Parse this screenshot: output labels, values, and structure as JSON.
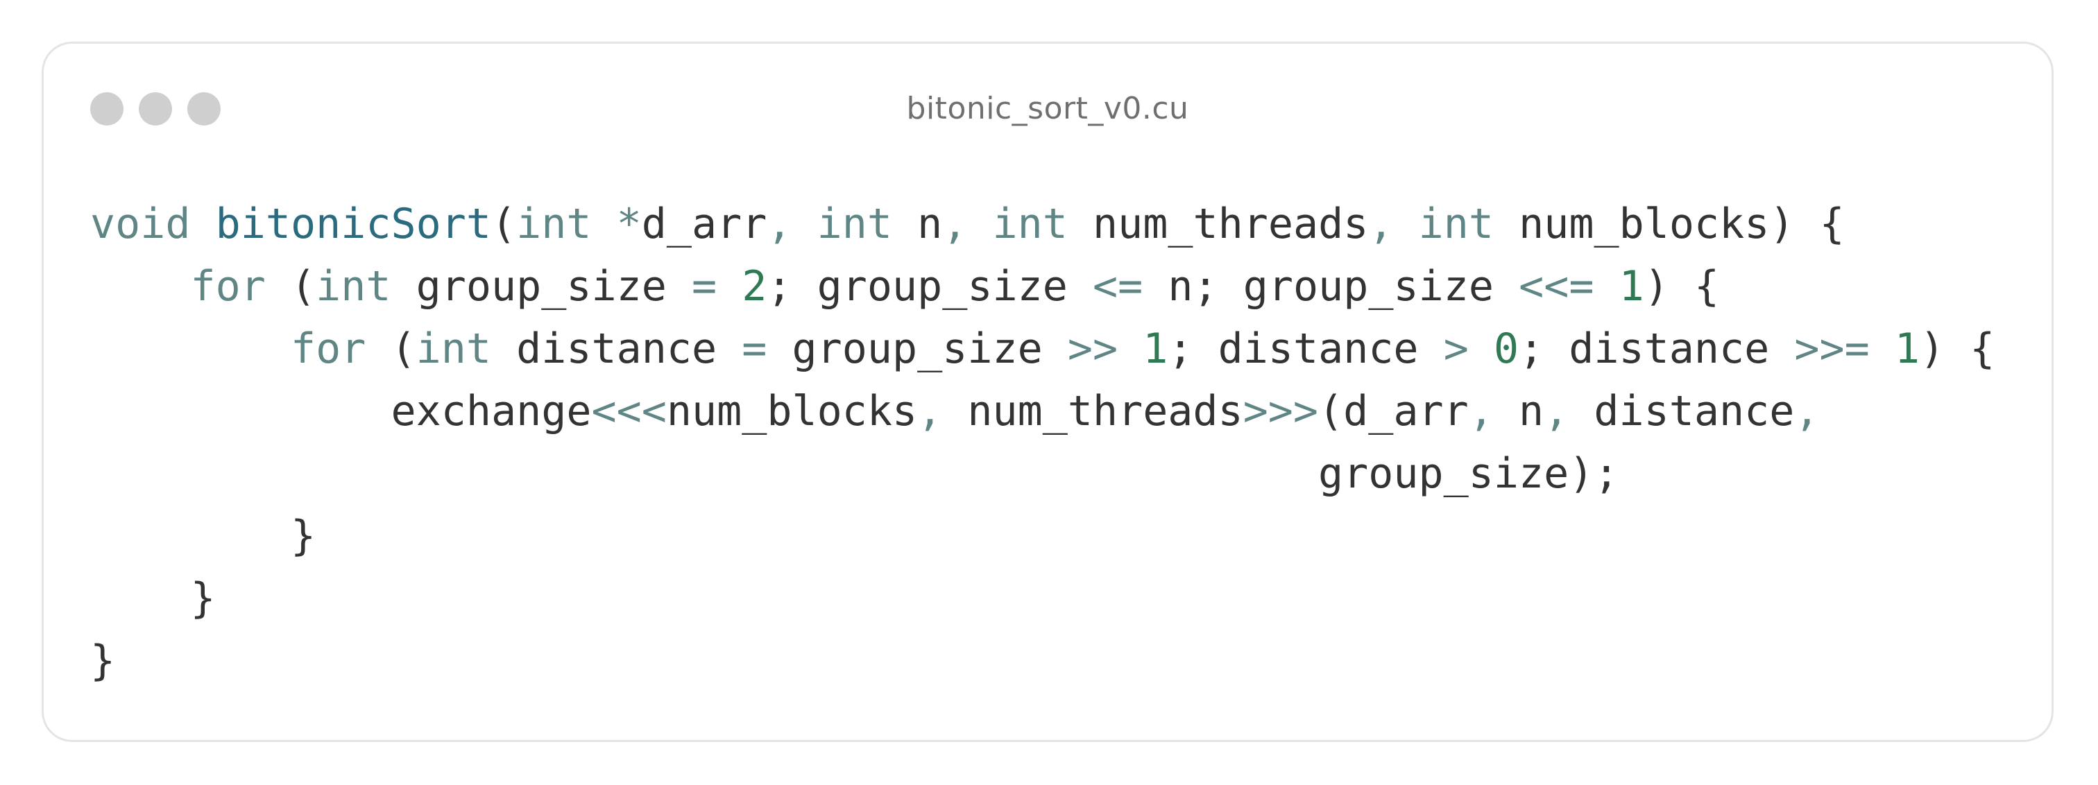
{
  "window": {
    "title": "bitonic_sort_v0.cu",
    "dots": [
      "window-dot-1",
      "window-dot-2",
      "window-dot-3"
    ]
  },
  "code": {
    "lines": [
      {
        "tokens": [
          {
            "t": "void",
            "c": "kw"
          },
          {
            "t": " ",
            "c": "id"
          },
          {
            "t": "bitonicSort",
            "c": "fn"
          },
          {
            "t": "(",
            "c": "id"
          },
          {
            "t": "int",
            "c": "kw"
          },
          {
            "t": " ",
            "c": "id"
          },
          {
            "t": "*",
            "c": "op"
          },
          {
            "t": "d_arr",
            "c": "id"
          },
          {
            "t": ",",
            "c": "op"
          },
          {
            "t": " ",
            "c": "id"
          },
          {
            "t": "int",
            "c": "kw"
          },
          {
            "t": " n",
            "c": "id"
          },
          {
            "t": ",",
            "c": "op"
          },
          {
            "t": " ",
            "c": "id"
          },
          {
            "t": "int",
            "c": "kw"
          },
          {
            "t": " num_threads",
            "c": "id"
          },
          {
            "t": ",",
            "c": "op"
          },
          {
            "t": " ",
            "c": "id"
          },
          {
            "t": "int",
            "c": "kw"
          },
          {
            "t": " num_blocks) {",
            "c": "id"
          }
        ]
      },
      {
        "tokens": [
          {
            "t": "    ",
            "c": "id"
          },
          {
            "t": "for",
            "c": "kw"
          },
          {
            "t": " (",
            "c": "id"
          },
          {
            "t": "int",
            "c": "kw"
          },
          {
            "t": " group_size ",
            "c": "id"
          },
          {
            "t": "=",
            "c": "op"
          },
          {
            "t": " ",
            "c": "id"
          },
          {
            "t": "2",
            "c": "num"
          },
          {
            "t": "; group_size ",
            "c": "id"
          },
          {
            "t": "<=",
            "c": "op"
          },
          {
            "t": " n; group_size ",
            "c": "id"
          },
          {
            "t": "<<=",
            "c": "op"
          },
          {
            "t": " ",
            "c": "id"
          },
          {
            "t": "1",
            "c": "num"
          },
          {
            "t": ") {",
            "c": "id"
          }
        ]
      },
      {
        "tokens": [
          {
            "t": "        ",
            "c": "id"
          },
          {
            "t": "for",
            "c": "kw"
          },
          {
            "t": " (",
            "c": "id"
          },
          {
            "t": "int",
            "c": "kw"
          },
          {
            "t": " distance ",
            "c": "id"
          },
          {
            "t": "=",
            "c": "op"
          },
          {
            "t": " group_size ",
            "c": "id"
          },
          {
            "t": ">>",
            "c": "op"
          },
          {
            "t": " ",
            "c": "id"
          },
          {
            "t": "1",
            "c": "num"
          },
          {
            "t": "; distance ",
            "c": "id"
          },
          {
            "t": ">",
            "c": "op"
          },
          {
            "t": " ",
            "c": "id"
          },
          {
            "t": "0",
            "c": "num"
          },
          {
            "t": "; distance ",
            "c": "id"
          },
          {
            "t": ">>=",
            "c": "op"
          },
          {
            "t": " ",
            "c": "id"
          },
          {
            "t": "1",
            "c": "num"
          },
          {
            "t": ") {",
            "c": "id"
          }
        ]
      },
      {
        "tokens": [
          {
            "t": "            exchange",
            "c": "id"
          },
          {
            "t": "<<<",
            "c": "op"
          },
          {
            "t": "num_blocks",
            "c": "id"
          },
          {
            "t": ",",
            "c": "op"
          },
          {
            "t": " num_threads",
            "c": "id"
          },
          {
            "t": ">>>",
            "c": "op"
          },
          {
            "t": "(d_arr",
            "c": "id"
          },
          {
            "t": ",",
            "c": "op"
          },
          {
            "t": " n",
            "c": "id"
          },
          {
            "t": ",",
            "c": "op"
          },
          {
            "t": " distance",
            "c": "id"
          },
          {
            "t": ",",
            "c": "op"
          }
        ]
      },
      {
        "tokens": [
          {
            "t": "                                                 group_size);",
            "c": "id"
          }
        ]
      },
      {
        "tokens": [
          {
            "t": "        }",
            "c": "id"
          }
        ]
      },
      {
        "tokens": [
          {
            "t": "    }",
            "c": "id"
          }
        ]
      },
      {
        "tokens": [
          {
            "t": "}",
            "c": "id"
          }
        ]
      }
    ]
  },
  "colors": {
    "keyword": "#5f8585",
    "function": "#2b6b80",
    "number": "#2f7a54",
    "operator": "#5f8585",
    "identifier": "#333333",
    "title": "#6f6f6f",
    "dot": "#cfcfcf",
    "border": "#e4e4e4"
  }
}
